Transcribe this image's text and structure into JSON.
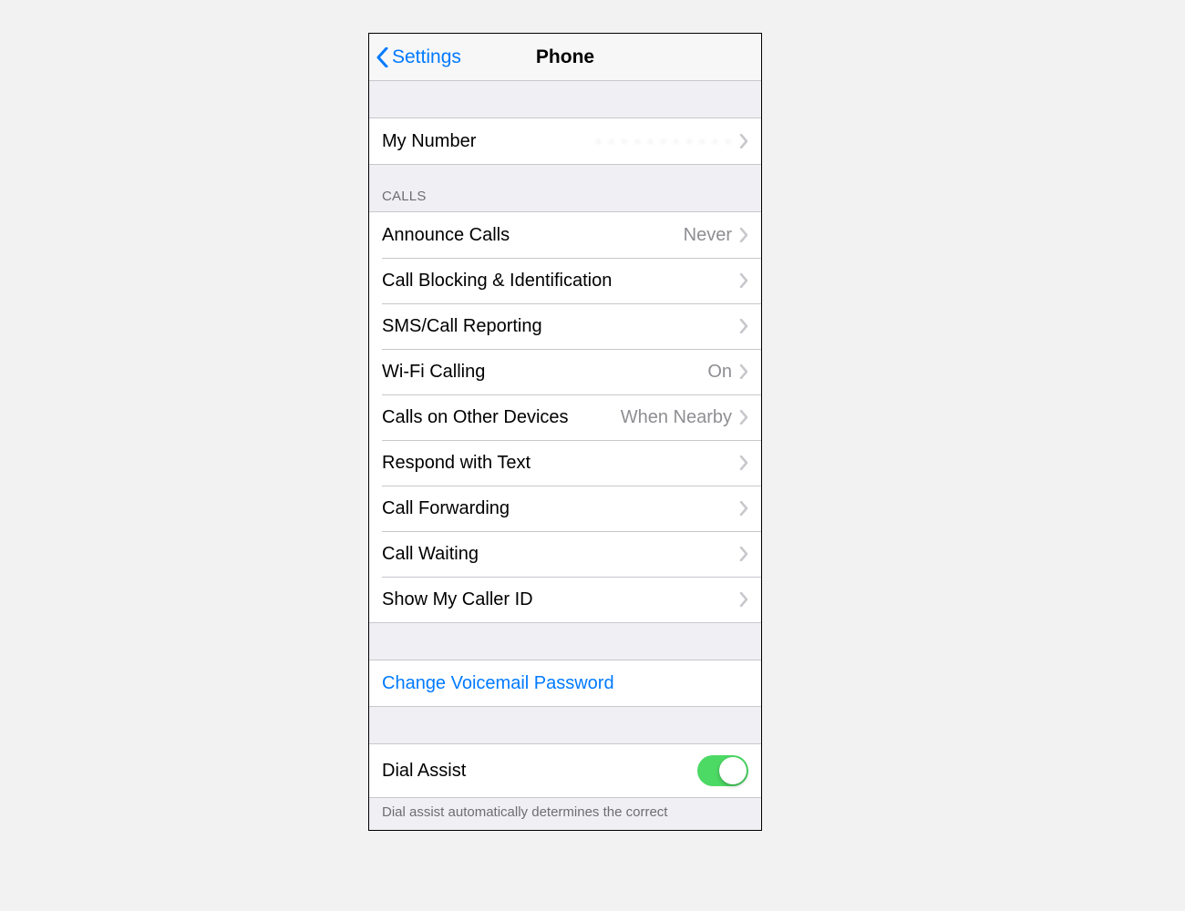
{
  "nav": {
    "back_label": "Settings",
    "title": "Phone"
  },
  "my_number": {
    "label": "My Number",
    "value": "· · · · · · · · · · ·"
  },
  "calls": {
    "header": "CALLS",
    "items": [
      {
        "label": "Announce Calls",
        "value": "Never"
      },
      {
        "label": "Call Blocking & Identification",
        "value": ""
      },
      {
        "label": "SMS/Call Reporting",
        "value": ""
      },
      {
        "label": "Wi-Fi Calling",
        "value": "On"
      },
      {
        "label": "Calls on Other Devices",
        "value": "When Nearby"
      },
      {
        "label": "Respond with Text",
        "value": ""
      },
      {
        "label": "Call Forwarding",
        "value": ""
      },
      {
        "label": "Call Waiting",
        "value": ""
      },
      {
        "label": "Show My Caller ID",
        "value": ""
      }
    ]
  },
  "voicemail": {
    "change_password": "Change Voicemail Password"
  },
  "dial_assist": {
    "label": "Dial Assist",
    "enabled": true,
    "footer": "Dial assist automatically determines the correct"
  }
}
